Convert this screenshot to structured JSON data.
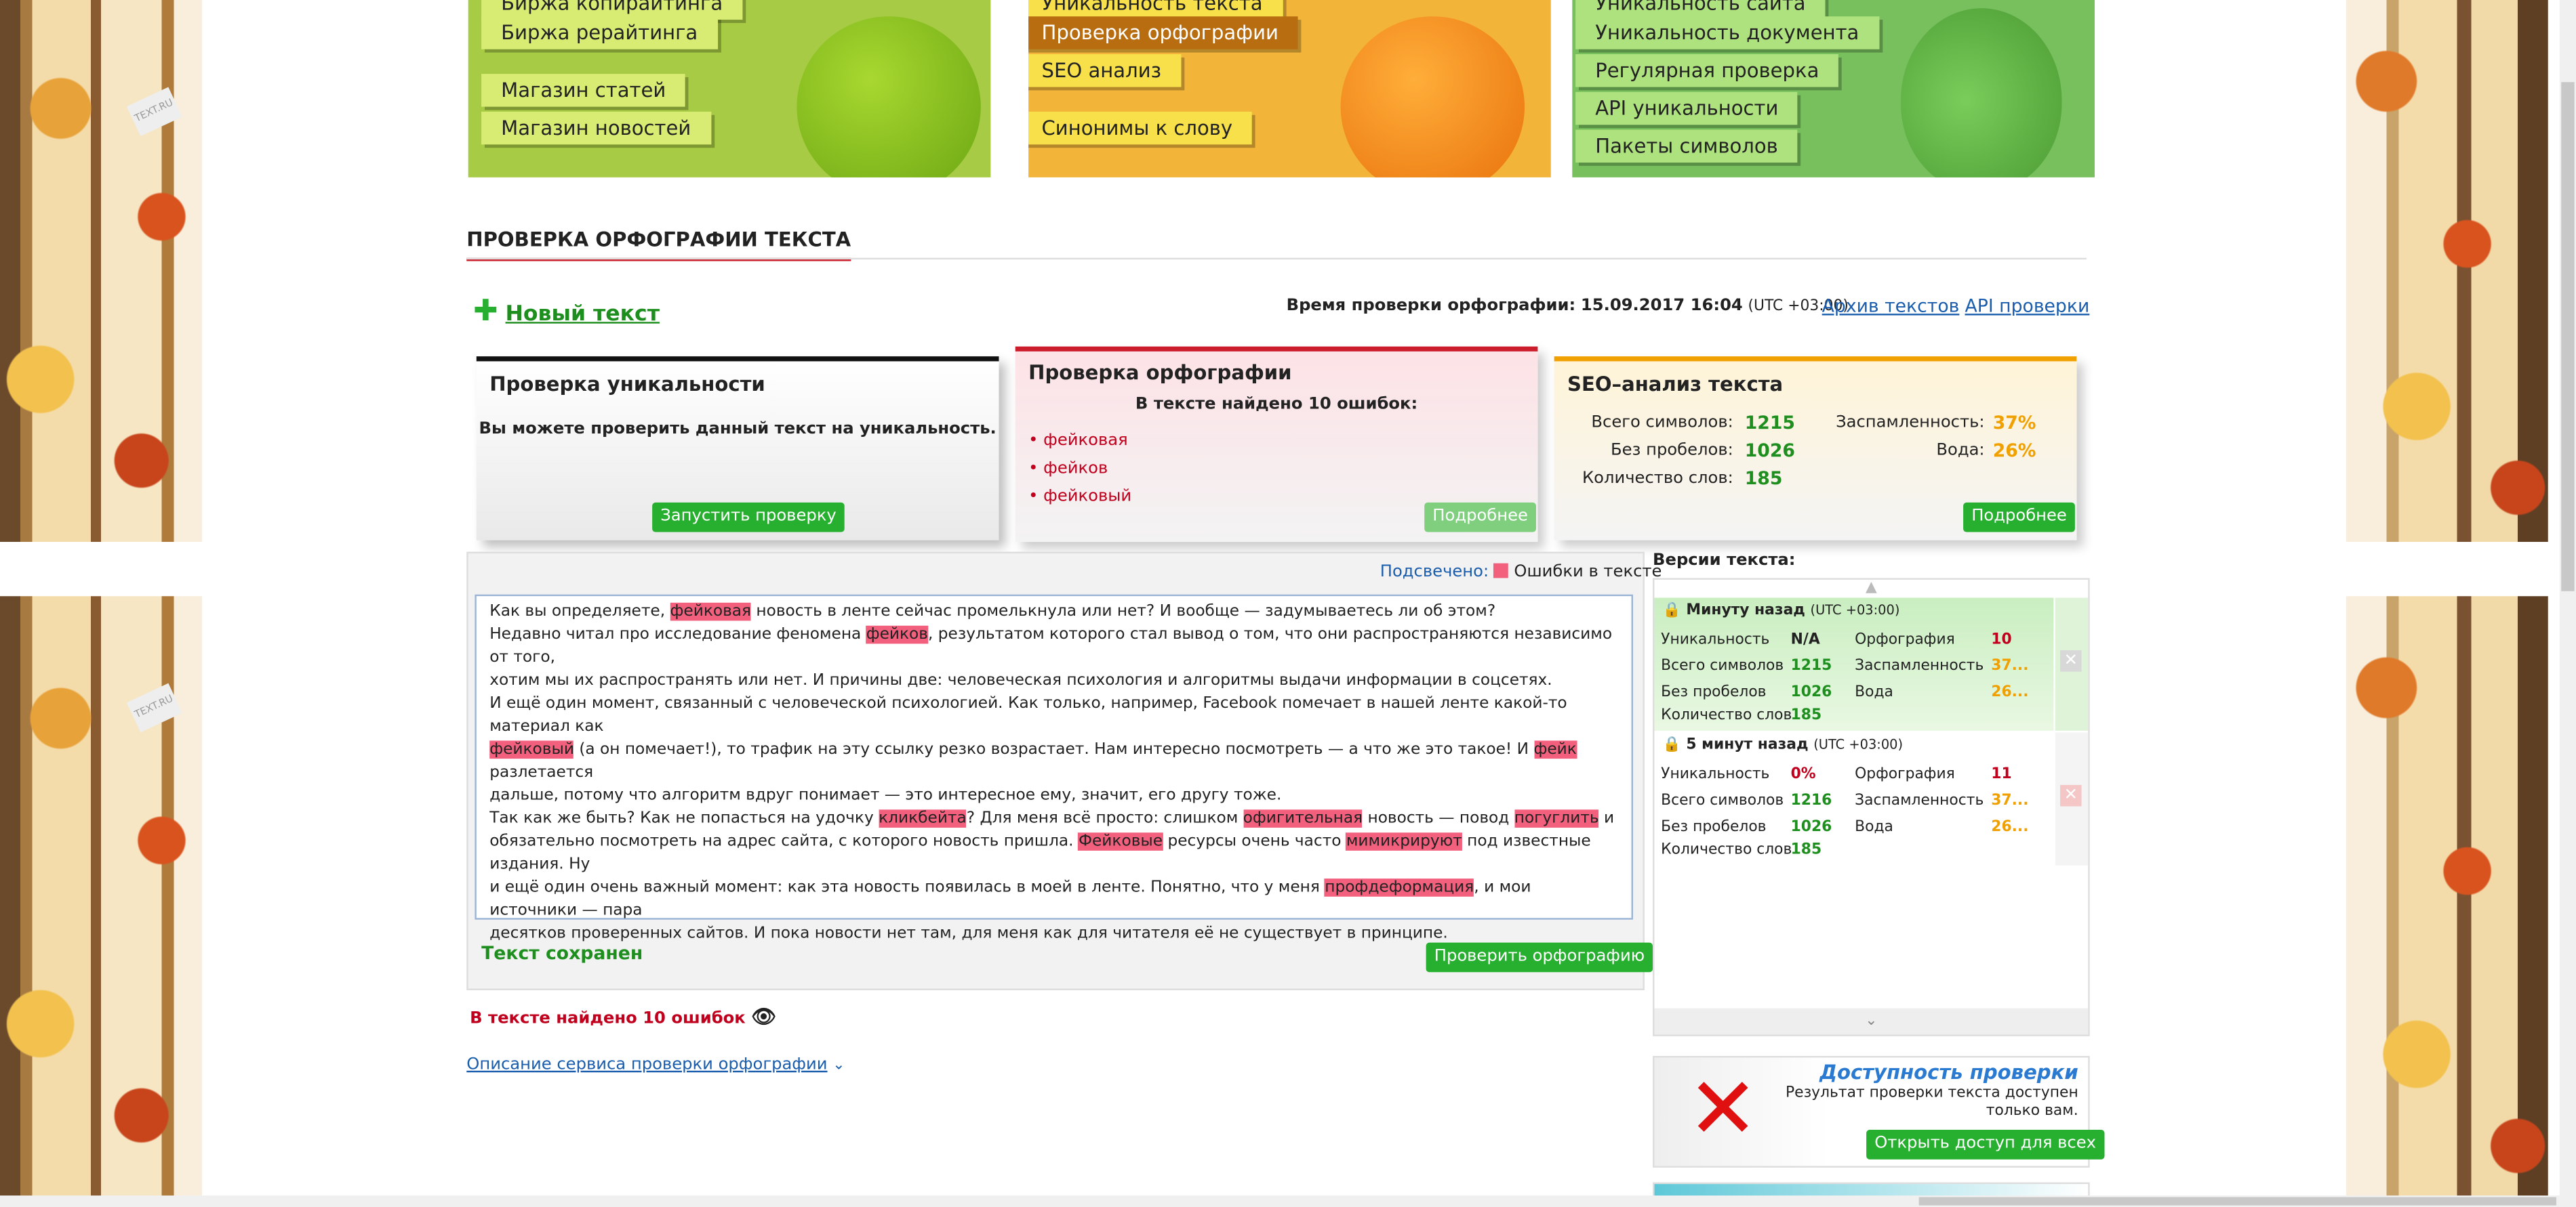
{
  "menus": {
    "green": [
      "Биржа копирайтинга",
      "Биржа рерайтинга",
      "Магазин статей",
      "Магазин новостей"
    ],
    "orange": [
      "Уникальность текста",
      "Проверка орфографии",
      "SEO анализ",
      "Синонимы к слову"
    ],
    "pear": [
      "Уникальность сайта",
      "Уникальность документа",
      "Регулярная проверка",
      "API уникальности",
      "Пакеты символов"
    ]
  },
  "page_title": "ПРОВЕРКА ОРФОГРАФИИ ТЕКСТА",
  "new_text": "Новый текст",
  "check_time_label": "Время проверки орфографии:",
  "check_time": "15.09.2017 16:04",
  "tz": "(UTC +03:00)",
  "archive_link": "Архив текстов",
  "api_link": "API проверки",
  "cards": {
    "unique": {
      "title": "Проверка уникальности",
      "text": "Вы можете проверить данный текст на уникальность.",
      "button": "Запустить проверку"
    },
    "spell": {
      "title": "Проверка орфографии",
      "summary": "В тексте найдено 10 ошибок:",
      "errors": [
        "фейковая",
        "фейков",
        "фейковый"
      ],
      "button": "Подробнее"
    },
    "seo": {
      "title": "SEO–анализ текста",
      "total_label": "Всего символов:",
      "total": "1215",
      "nospace_label": "Без пробелов:",
      "nospace": "1026",
      "words_label": "Количество слов:",
      "words": "185",
      "spam_label": "Заспамленность:",
      "spam": "37%",
      "water_label": "Вода:",
      "water": "26%",
      "button": "Подробнее"
    }
  },
  "highlighted_label": "Подсвечено:",
  "highlight_legend": "Ошибки в тексте",
  "text_lines": [
    [
      "Как вы определяете, ",
      {
        "h": "фейковая"
      },
      " новость в ленте сейчас промелькнула или нет? И вообще — задумываетесь ли об этом?"
    ],
    [
      "Недавно читал про исследование феномена ",
      {
        "h": "фейков"
      },
      ", результатом которого стал вывод о том, что они распространяются независимо от того,"
    ],
    [
      "хотим мы их распространять или нет. И причины две: человеческая психология и алгоритмы выдачи информации в соцсетях."
    ],
    [
      "И ещё один момент, связанный с человеческой психологией. Как только, например, Facebook помечает в нашей ленте какой-то материал как"
    ],
    [
      {
        "h": "фейковый"
      },
      " (а он помечает!), то трафик на эту ссылку резко возрастает. Нам интересно посмотреть — а что же это такое! И ",
      {
        "h": "фейк"
      },
      " разлетается"
    ],
    [
      "дальше, потому что алгоритм вдруг понимает — это интересное ему, значит, его другу тоже."
    ],
    [
      "Так как же быть? Как не попасться на удочку ",
      {
        "h": "кликбейта"
      },
      "? Для меня всё просто: слишком ",
      {
        "h": "офигительная"
      },
      " новость — повод ",
      {
        "h": "погуглить"
      },
      " и"
    ],
    [
      "обязательно посмотреть на адрес сайта, с которого новость пришла. ",
      {
        "h": "Фейковые"
      },
      " ресурсы очень часто ",
      {
        "h": "мимикрируют"
      },
      " под известные издания. Ну"
    ],
    [
      "и ещё один очень важный момент: как эта новость появилась в моей в ленте. Понятно, что у меня ",
      {
        "h": "профдеформация"
      },
      ", и мои источники — пара"
    ],
    [
      "десятков проверенных сайтов. И пока новости нет там, для меня как для читателя её не существует в принципе."
    ]
  ],
  "saved": "Текст сохранен",
  "check_button": "Проверить орфографию",
  "errors_found": "В тексте найдено 10 ошибок",
  "description_link": "Описание сервиса проверки орфографии",
  "versions": {
    "title": "Версии текста:",
    "items": [
      {
        "time": "Минуту назад",
        "tz": "(UTC +03:00)",
        "unique_label": "Уникальность",
        "unique": "N/A",
        "spell_label": "Орфография",
        "spell": "10",
        "total_label": "Всего символов",
        "total": "1215",
        "spam_label": "Заспамленность",
        "spam": "37...",
        "nospace_label": "Без пробелов",
        "nospace": "1026",
        "water_label": "Вода",
        "water": "26...",
        "words_label": "Количество слов",
        "words": "185"
      },
      {
        "time": "5 минут назад",
        "tz": "(UTC +03:00)",
        "unique_label": "Уникальность",
        "unique": "0%",
        "spell_label": "Орфография",
        "spell": "11",
        "total_label": "Всего символов",
        "total": "1216",
        "spam_label": "Заспамленность",
        "spam": "37...",
        "nospace_label": "Без пробелов",
        "nospace": "1026",
        "water_label": "Вода",
        "water": "26...",
        "words_label": "Количество слов",
        "words": "185"
      }
    ]
  },
  "access": {
    "title": "Доступность проверки",
    "text1": "Результат проверки текста доступен",
    "text2": "только вам.",
    "button": "Открыть доступ для всех"
  },
  "colors": {
    "accent_red": "#cc1d2c",
    "green": "#27b02f",
    "highlight": "#f2607d",
    "link": "#1a5dad"
  }
}
